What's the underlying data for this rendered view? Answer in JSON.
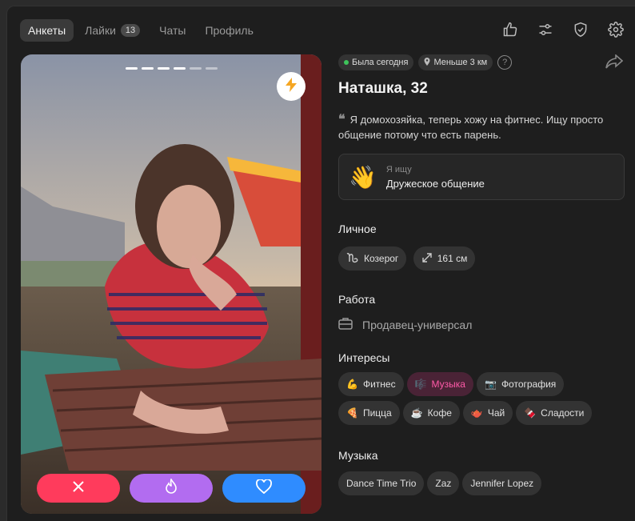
{
  "nav": {
    "tabs": [
      {
        "label": "Анкеты"
      },
      {
        "label": "Лайки",
        "badge": "13"
      },
      {
        "label": "Чаты"
      },
      {
        "label": "Профиль"
      }
    ]
  },
  "top_icons": [
    "thumbs-up-icon",
    "sliders-icon",
    "shield-check-icon",
    "gear-icon"
  ],
  "photo": {
    "total_slides": 6,
    "current_slide": 4
  },
  "profile": {
    "status": "Была сегодня",
    "distance": "Меньше 3 км",
    "help": "?",
    "name": "Наташка, 32",
    "quote_mark": "❝",
    "bio": "Я домохозяйка, теперь хожу на фитнес. Ищу просто общение потому что есть парень.",
    "seeking_label": "Я ищу",
    "seeking_value": "Дружеское общение",
    "seeking_emoji": "👋"
  },
  "personal": {
    "title": "Личное",
    "zodiac": "Козерог",
    "height": "161 см"
  },
  "work": {
    "title": "Работа",
    "value": "Продавец-универсал"
  },
  "interests": {
    "title": "Интересы",
    "items": [
      {
        "emoji": "💪",
        "label": "Фитнес"
      },
      {
        "emoji": "🎼",
        "label": "Музыка"
      },
      {
        "emoji": "📷",
        "label": "Фотография"
      },
      {
        "emoji": "🍕",
        "label": "Пицца"
      },
      {
        "emoji": "☕",
        "label": "Кофе"
      },
      {
        "emoji": "🫖",
        "label": "Чай"
      },
      {
        "emoji": "🍫",
        "label": "Сладости"
      }
    ]
  },
  "music": {
    "title": "Музыка",
    "items": [
      "Dance Time Trio",
      "Zaz",
      "Jennifer Lopez"
    ]
  },
  "colors": {
    "accent_pink": "#ff5aa8",
    "dislike": "#ff3b5c",
    "superlike": "#b26cf0",
    "like": "#2f8cff",
    "online": "#3ec45b"
  }
}
